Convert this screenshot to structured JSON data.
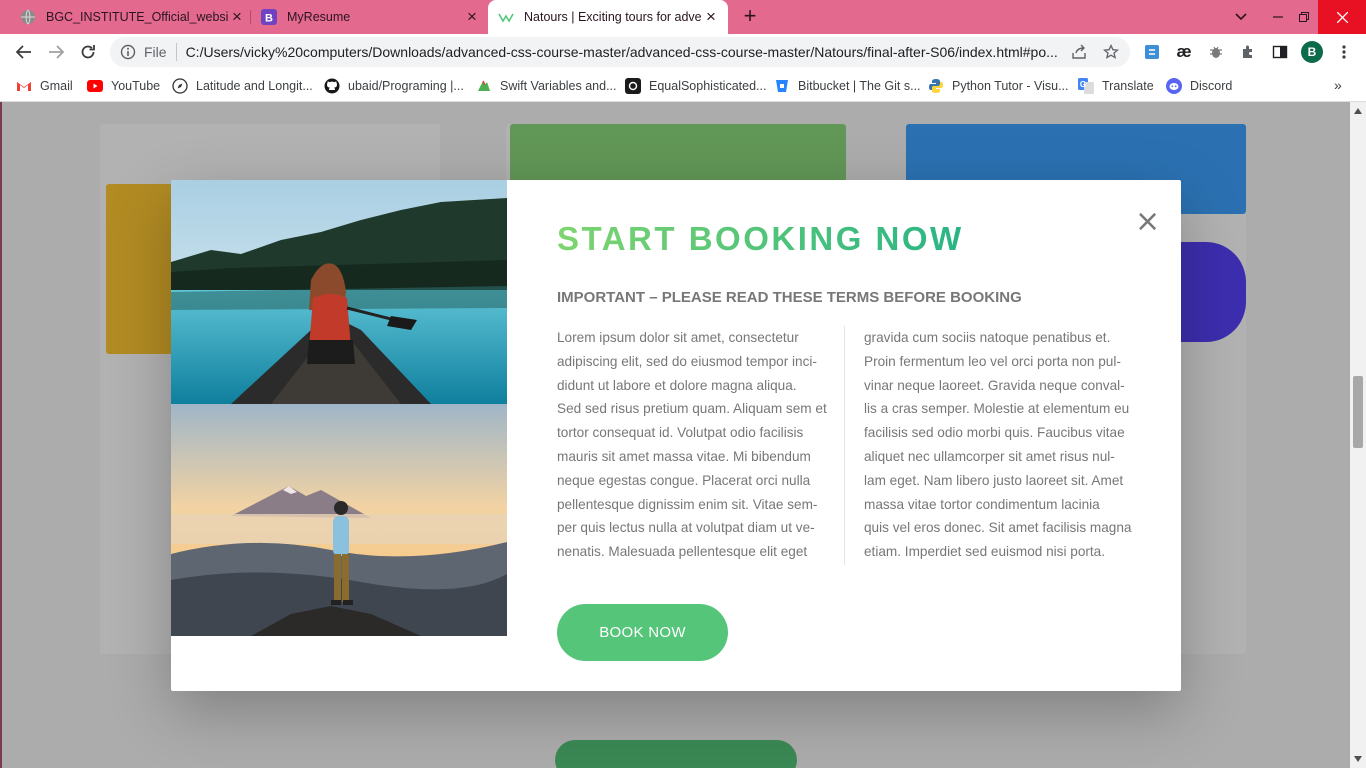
{
  "browser": {
    "tabs": [
      {
        "title": "BGC_INSTITUTE_Official_website",
        "favicon": "globe-icon"
      },
      {
        "title": "MyResume",
        "favicon": "bootstrap-icon"
      },
      {
        "title": "Natours | Exciting tours for adver",
        "favicon": "natours-icon",
        "active": true
      }
    ],
    "new_tab_label": "+",
    "nav": {
      "back": "back-icon",
      "forward": "forward-icon",
      "reload": "reload-icon"
    },
    "omnibox": {
      "scheme_label": "File",
      "url": "C:/Users/vicky%20computers/Downloads/advanced-css-course-master/advanced-css-course-master/Natours/final-after-S06/index.html#po..."
    },
    "profile_initial": "B",
    "bookmarks": [
      {
        "label": "Gmail",
        "icon": "gmail-icon"
      },
      {
        "label": "YouTube",
        "icon": "youtube-icon"
      },
      {
        "label": "Latitude and Longit...",
        "icon": "compass-icon"
      },
      {
        "label": "ubaid/Programing |...",
        "icon": "github-icon"
      },
      {
        "label": "Swift Variables and...",
        "icon": "swift-icon"
      },
      {
        "label": "EqualSophisticated...",
        "icon": "replit-icon"
      },
      {
        "label": "Bitbucket | The Git s...",
        "icon": "bitbucket-icon"
      },
      {
        "label": "Python Tutor - Visu...",
        "icon": "python-icon"
      },
      {
        "label": "Translate",
        "icon": "translate-icon"
      },
      {
        "label": "Discord",
        "icon": "discord-icon"
      }
    ],
    "bookmarks_overflow": "»"
  },
  "popup": {
    "heading": "START BOOKING NOW",
    "subheading": "IMPORTANT – PLEASE READ THESE TERMS BEFORE BOOKING",
    "close_symbol": "×",
    "col_left": [
      "Lorem ipsum dolor sit amet, consectetur",
      "adipiscing elit, sed do eiusmod tempor inci-",
      "didunt ut labore et dolore magna aliqua.",
      "Sed sed risus pretium quam. Aliquam sem et",
      "tortor consequat id. Volutpat odio facilisis",
      "mauris sit amet massa vitae. Mi bibendum",
      "neque egestas congue. Placerat orci nulla",
      "pellentesque dignissim enim sit. Vitae sem-",
      "per quis lectus nulla at volutpat diam ut ve-",
      "nenatis. Malesuada pellentesque elit eget"
    ],
    "col_right": [
      "gravida cum sociis natoque penatibus et.",
      "Proin fermentum leo vel orci porta non pul-",
      "vinar neque laoreet. Gravida neque conval-",
      "lis a cras semper. Molestie at elementum eu",
      "facilisis sed odio morbi quis. Faucibus vitae",
      "aliquet nec ullamcorper sit amet risus nul-",
      "lam eget. Nam libero justo laoreet sit. Amet",
      "massa vitae tortor condimentum lacinia",
      "quis vel eros donec. Sit amet facilisis magna",
      "etiam. Imperdiet sed euismod nisi porta."
    ],
    "button_label": "BOOK NOW"
  },
  "colors": {
    "tab_strip": "#e4698f",
    "brand_green": "#55c57a",
    "heading_gradient": [
      "#7ed56f",
      "#28b485"
    ]
  }
}
